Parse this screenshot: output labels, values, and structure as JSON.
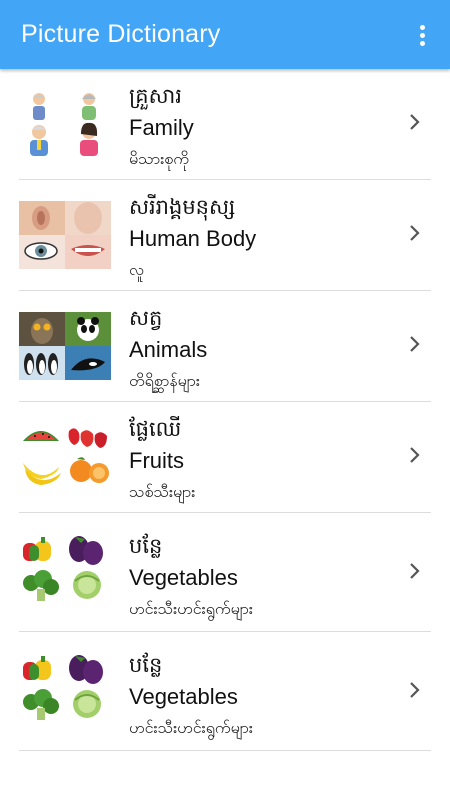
{
  "app_bar": {
    "title": "Picture Dictionary",
    "accent_color": "#42a5f5",
    "menu_icon": "overflow-vertical-dots-icon"
  },
  "categories": [
    {
      "khmer": "គ្រួសារ",
      "english": "Family",
      "burmese": "မိသားစုကို",
      "thumbnail": "family-members-icon"
    },
    {
      "khmer": "សរីរាង្គមនុស្ស",
      "english": "Human Body",
      "burmese": "လူ",
      "thumbnail": "human-body-parts-icon"
    },
    {
      "khmer": "សត្វ",
      "english": "Animals",
      "burmese": "တိရိစ္ဆာန်များ",
      "thumbnail": "animals-icon"
    },
    {
      "khmer": "ផ្លែឈើ",
      "english": "Fruits",
      "burmese": "သစ်သီးများ",
      "thumbnail": "fruits-icon"
    },
    {
      "khmer": "បន្លែ",
      "english": "Vegetables",
      "burmese": "ဟင်းသီးဟင်းရွက်များ",
      "thumbnail": "vegetables-icon"
    },
    {
      "khmer": "បន្លែ",
      "english": "Vegetables",
      "burmese": "ဟင်းသီးဟင်းရွက်များ",
      "thumbnail": "vegetables-icon"
    }
  ]
}
